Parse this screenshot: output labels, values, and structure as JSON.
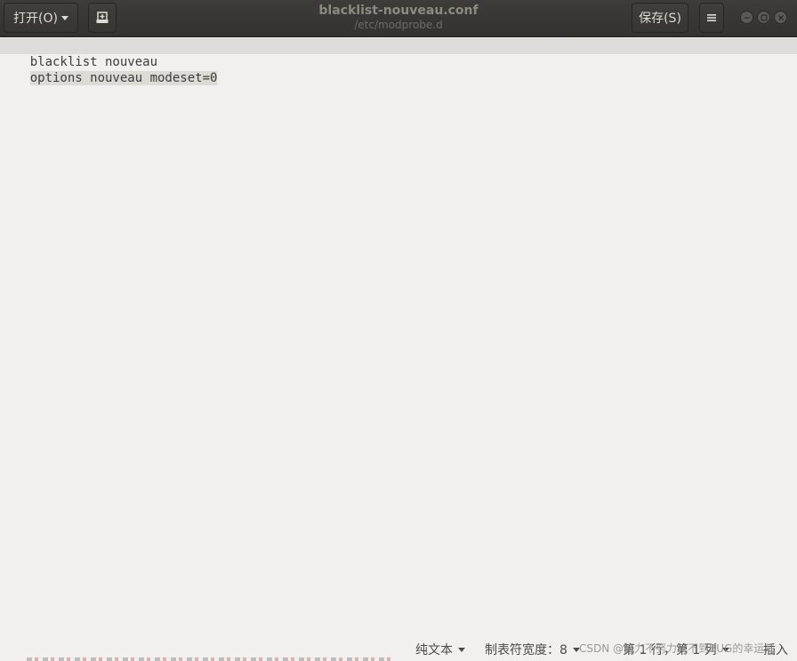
{
  "header": {
    "open_label": "打开(O)",
    "save_label": "保存(S)",
    "title": "blacklist-nouveau.conf",
    "subtitle": "/etc/modprobe.d",
    "icons": {
      "open_arrow": "chevron-down-icon",
      "new_tab": "new-document-icon",
      "menu": "hamburger-menu-icon",
      "minimize": "minimize-icon",
      "maximize": "maximize-icon",
      "close": "close-icon"
    }
  },
  "editor": {
    "lines": [
      "blacklist nouveau",
      "options nouveau modeset=0"
    ]
  },
  "statusbar": {
    "language": "纯文本",
    "tab_width": "制表符宽度：8",
    "position": "第 1 行，第 1 列",
    "mode": "插入"
  },
  "watermark": "CSDN @努力不努力就不到BUG的幸运儿"
}
